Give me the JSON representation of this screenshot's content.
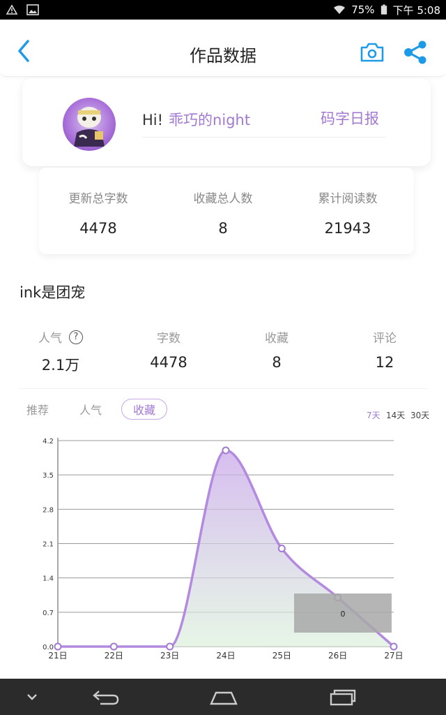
{
  "status_bar": {
    "battery": "75%",
    "time": "下午 5:08"
  },
  "header": {
    "title": "作品数据"
  },
  "profile": {
    "greeting": "Hi!",
    "username": "乖巧的night",
    "daily_report_link": "码字日报"
  },
  "totals": [
    {
      "label": "更新总字数",
      "value": "4478"
    },
    {
      "label": "收藏总人数",
      "value": "8"
    },
    {
      "label": "累计阅读数",
      "value": "21943"
    }
  ],
  "work": {
    "title": "ink是团宠",
    "stats": [
      {
        "label": "人气",
        "value": "2.1万"
      },
      {
        "label": "字数",
        "value": "4478"
      },
      {
        "label": "收藏",
        "value": "8"
      },
      {
        "label": "评论",
        "value": "12"
      }
    ]
  },
  "chart_tabs": [
    "推荐",
    "人气",
    "收藏"
  ],
  "active_tab": "收藏",
  "range_options": [
    "7天",
    "14天",
    "30天"
  ],
  "active_range": "7天",
  "tooltip": {
    "value": "0"
  },
  "colors": {
    "accent": "#a27ad1",
    "link_blue": "#1e9be8"
  },
  "chart_data": {
    "type": "area",
    "categories": [
      "21日",
      "22日",
      "23日",
      "24日",
      "25日",
      "26日",
      "27日"
    ],
    "values": [
      0,
      0,
      0,
      4,
      2,
      1,
      0
    ],
    "y_ticks": [
      "0.0",
      "0.7",
      "1.4",
      "2.1",
      "2.8",
      "3.5",
      "4.2"
    ],
    "ylim": [
      0,
      4.2
    ],
    "grid": true
  }
}
